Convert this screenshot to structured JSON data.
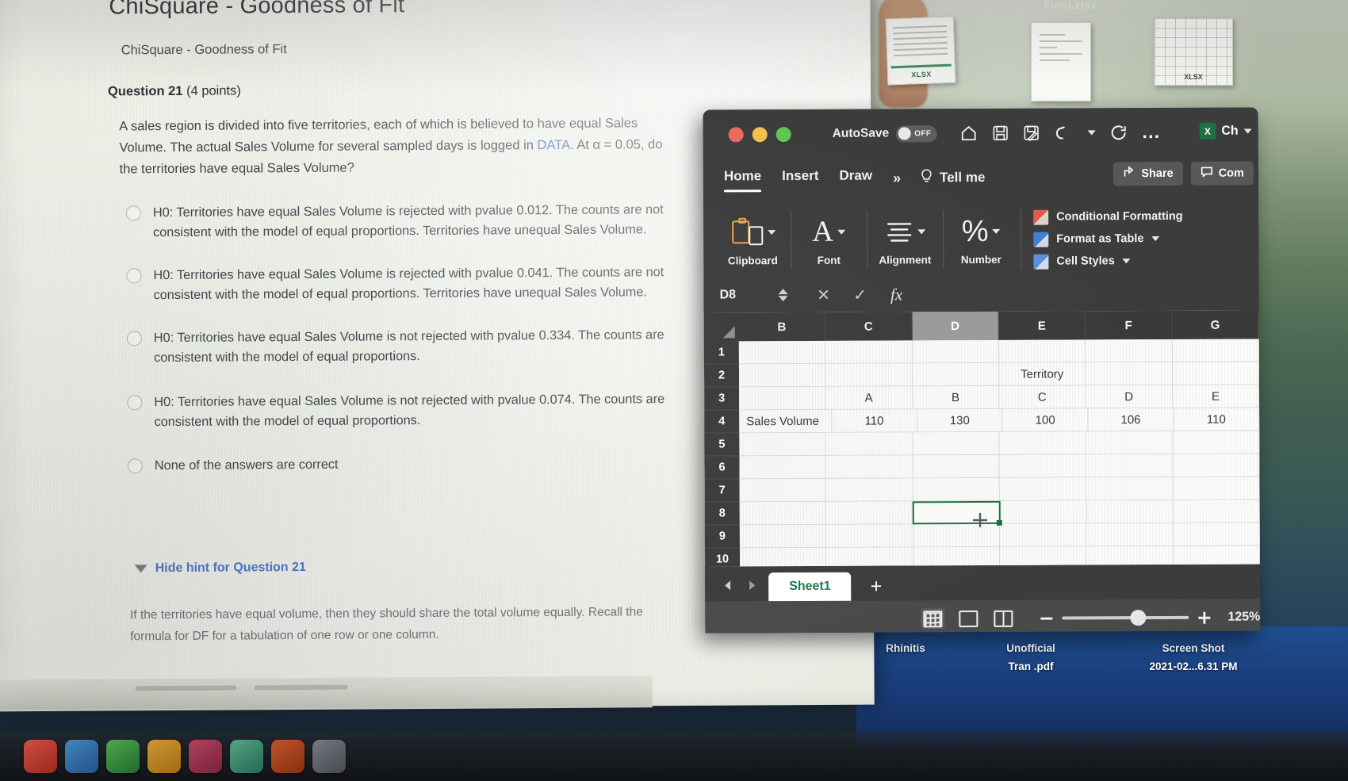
{
  "quiz": {
    "title": "ChiSquare - Goodness of Fit",
    "subtitle": "ChiSquare - Goodness of Fit",
    "question_label": "Question 21",
    "points": "(4 points)",
    "body_1": "A sales region is divided into five territories, each of which is believed to have equal Sales Volume. The actual Sales Volume for several sampled days is logged in ",
    "body_link": "DATA",
    "body_2": ". At α = 0.05, do the territories have equal Sales Volume?",
    "options": [
      "H0: Territories have equal Sales Volume is rejected with pvalue 0.012. The counts are not consistent with the model of equal proportions. Territories have unequal Sales Volume.",
      "H0: Territories have equal Sales Volume is rejected with pvalue 0.041. The counts are not consistent with the model of equal proportions. Territories have unequal Sales Volume.",
      "H0: Territories have equal Sales Volume is not rejected with pvalue 0.334.  The counts are consistent with the model of equal proportions.",
      "H0: Territories have equal Sales Volume is not rejected with pvalue 0.074.  The counts are consistent with the model of equal proportions.",
      "None of the answers are correct"
    ],
    "hint_toggle": "Hide hint for Question 21",
    "hint_body": "If the territories have equal volume, then they should share the total volume equally. Recall the formula for DF for a tabulation of one row or one column."
  },
  "excel": {
    "autosave_label": "AutoSave",
    "autosave_state": "OFF",
    "quick_access": [
      "home-icon",
      "save-icon",
      "save-as-icon",
      "undo-icon",
      "redo-icon",
      "more-icon"
    ],
    "file_name": "Ch",
    "tabs": [
      "Home",
      "Insert",
      "Draw"
    ],
    "overflow": "»",
    "tell_me": "Tell me",
    "share_label": "Share",
    "comments_label": "Com",
    "groups": [
      {
        "label": "Clipboard",
        "icon": "clipboard-icon"
      },
      {
        "label": "Font",
        "icon": "font-icon"
      },
      {
        "label": "Alignment",
        "icon": "alignment-icon"
      },
      {
        "label": "Number",
        "icon": "percent-icon"
      }
    ],
    "styles": [
      {
        "label": "Conditional Formatting",
        "icon": "conditional-formatting-icon"
      },
      {
        "label": "Format as Table",
        "icon": "format-as-table-icon"
      },
      {
        "label": "Cell Styles",
        "icon": "cell-styles-icon"
      }
    ],
    "name_box": "D8",
    "formula_value": "",
    "column_headers": [
      "B",
      "C",
      "D",
      "E",
      "F",
      "G"
    ],
    "selected_column": "D",
    "row_headers": [
      "1",
      "2",
      "3",
      "4",
      "5",
      "6",
      "7",
      "8",
      "9",
      "10"
    ],
    "cells": {
      "row2": [
        "",
        "",
        "",
        "Territory",
        "",
        ""
      ],
      "row3": [
        "",
        "A",
        "B",
        "C",
        "D",
        "E"
      ],
      "row4": [
        "Sales Volume",
        "110",
        "130",
        "100",
        "106",
        "110"
      ]
    },
    "selected_cell": "D8",
    "sheet_tab": "Sheet1",
    "add_sheet": "+",
    "zoom": "125%"
  },
  "desktop": {
    "top_filename": "Final.xlsx",
    "file_tags": [
      "XLSX",
      "XLSX"
    ],
    "stack_labels": [
      "Rhinitis",
      "Unofficial\nTran .pdf",
      "Screen Shot\n2021-02...6.31 PM"
    ],
    "stack_label_1": "Rhinitis",
    "stack_label_2a": "Unofficial",
    "stack_label_2b": "Tran .pdf",
    "stack_label_3a": "Screen Shot",
    "stack_label_3b": "2021-02...6.31 PM"
  },
  "colors": {
    "link": "#3d6fc4",
    "hint_link": "#4a78c8",
    "excel_green": "#1f7a4d",
    "traffic_red": "#ec6a5e",
    "traffic_yellow": "#f4bf4f",
    "traffic_green": "#61c554"
  }
}
